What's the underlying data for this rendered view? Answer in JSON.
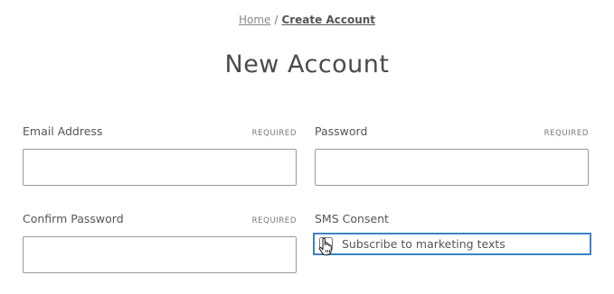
{
  "breadcrumb": {
    "home": "Home",
    "separator": "/",
    "current": "Create Account"
  },
  "page_title": "New Account",
  "form": {
    "email": {
      "label": "Email Address",
      "required": "REQUIRED",
      "value": ""
    },
    "password": {
      "label": "Password",
      "required": "REQUIRED",
      "value": ""
    },
    "confirm_password": {
      "label": "Confirm Password",
      "required": "REQUIRED",
      "value": ""
    },
    "sms_consent": {
      "label": "SMS Consent",
      "checkbox_label": "Subscribe to marketing texts",
      "checked": false
    }
  },
  "colors": {
    "focus_ring": "#3b82c4",
    "input_border": "#9a9a9a",
    "text": "#555555"
  },
  "icons": {
    "cursor": "hand-pointer-icon"
  }
}
